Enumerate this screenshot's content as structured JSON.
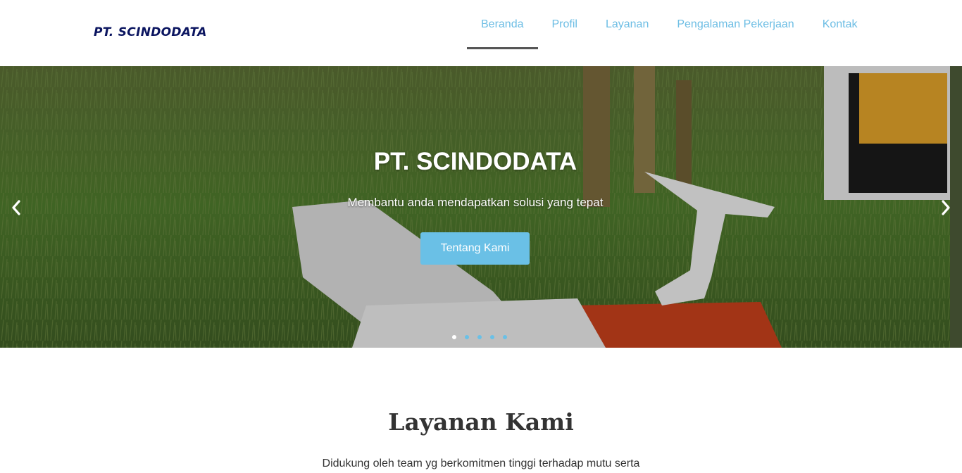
{
  "header": {
    "logo": "PT. SCINDODATA",
    "nav": [
      {
        "label": "Beranda",
        "active": true
      },
      {
        "label": "Profil",
        "active": false
      },
      {
        "label": "Layanan",
        "active": false
      },
      {
        "label": "Pengalaman Pekerjaan",
        "active": false
      },
      {
        "label": "Kontak",
        "active": false
      }
    ]
  },
  "hero": {
    "title": "PT. SCINDODATA",
    "subtitle": "Membantu anda mendapatkan solusi yang tepat",
    "button_label": "Tentang Kami",
    "prev_icon": "chevron-left-icon",
    "next_icon": "chevron-right-icon",
    "slide_count": 5,
    "active_slide": 1
  },
  "section": {
    "title": "Layanan Kami",
    "text": "Didukung oleh team yg berkomitmen tinggi terhadap mutu serta"
  },
  "colors": {
    "logo": "#0b1560",
    "nav_text": "#6cbde4",
    "accent": "#6ac0e6",
    "active_underline": "#555555"
  }
}
